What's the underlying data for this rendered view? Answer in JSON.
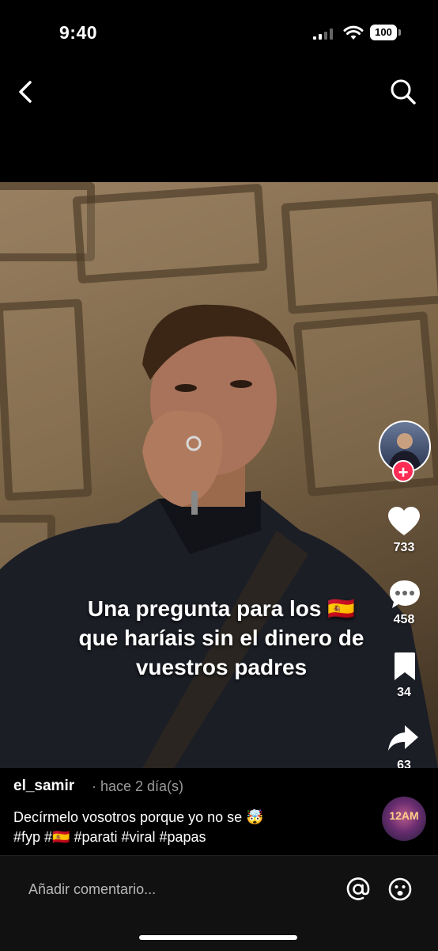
{
  "status": {
    "time": "9:40",
    "battery": "100"
  },
  "video": {
    "caption_line1": "Una pregunta para los 🇪🇸",
    "caption_line2": "que haríais sin el dinero de",
    "caption_line3": "vuestros padres"
  },
  "rail": {
    "likes": "733",
    "comments": "458",
    "saves": "34",
    "shares": "63"
  },
  "post": {
    "username": "el_samir",
    "time_ago": "· hace 2 día(s)",
    "description_line1": "Decírmelo vosotros porque yo no se 🤯",
    "description_line2": "#fyp #🇪🇸 #parati #viral #papas",
    "music_label": "12AM"
  },
  "comment": {
    "placeholder": "Añadir comentario..."
  },
  "colors": {
    "accent": "#fe2c55",
    "background": "#000000"
  },
  "icons": [
    "back-icon",
    "search-icon",
    "heart-icon",
    "comment-icon",
    "bookmark-icon",
    "share-icon",
    "at-icon",
    "emoji-icon"
  ]
}
